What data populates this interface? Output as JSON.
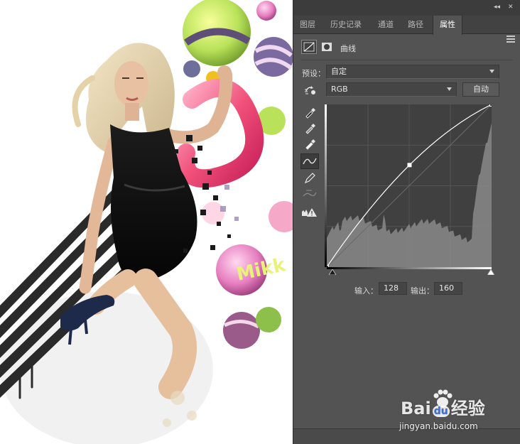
{
  "panel": {
    "tabs": [
      {
        "label": "图层",
        "active": false
      },
      {
        "label": "历史记录",
        "active": false
      },
      {
        "label": "通道",
        "active": false
      },
      {
        "label": "路径",
        "active": false
      },
      {
        "label": "属性",
        "active": true
      }
    ],
    "top_controls": {
      "collapse": "◂◂",
      "close": "✕"
    },
    "properties": {
      "title": "曲线",
      "preset_label": "预设：",
      "preset_value": "自定",
      "channel_value": "RGB",
      "auto_button": "自动",
      "input_label": "输入：",
      "input_value": "128",
      "output_label": "输出：",
      "output_value": "160"
    },
    "tools": [
      {
        "name": "on-image-adjust-icon",
        "active": false
      },
      {
        "name": "black-point-eyedropper-icon",
        "active": false
      },
      {
        "name": "gray-point-eyedropper-icon",
        "active": false
      },
      {
        "name": "white-point-eyedropper-icon",
        "active": false
      },
      {
        "name": "curve-point-icon",
        "active": true
      },
      {
        "name": "pencil-icon",
        "active": false
      },
      {
        "name": "smooth-curve-icon",
        "active": false
      },
      {
        "name": "clipping-warning-icon",
        "active": false
      }
    ],
    "curve": {
      "points": [
        [
          0,
          0
        ],
        [
          128,
          160
        ],
        [
          255,
          255
        ]
      ]
    },
    "colors": {
      "panel_bg": "#535353",
      "graph_bg": "#404040",
      "histogram": "#8a8a8a",
      "curve": "#ffffff"
    }
  },
  "watermark": {
    "brand": "Bai",
    "brand_suffix": "du",
    "chinese": "经验",
    "url": "jingyan.baidu.com"
  }
}
